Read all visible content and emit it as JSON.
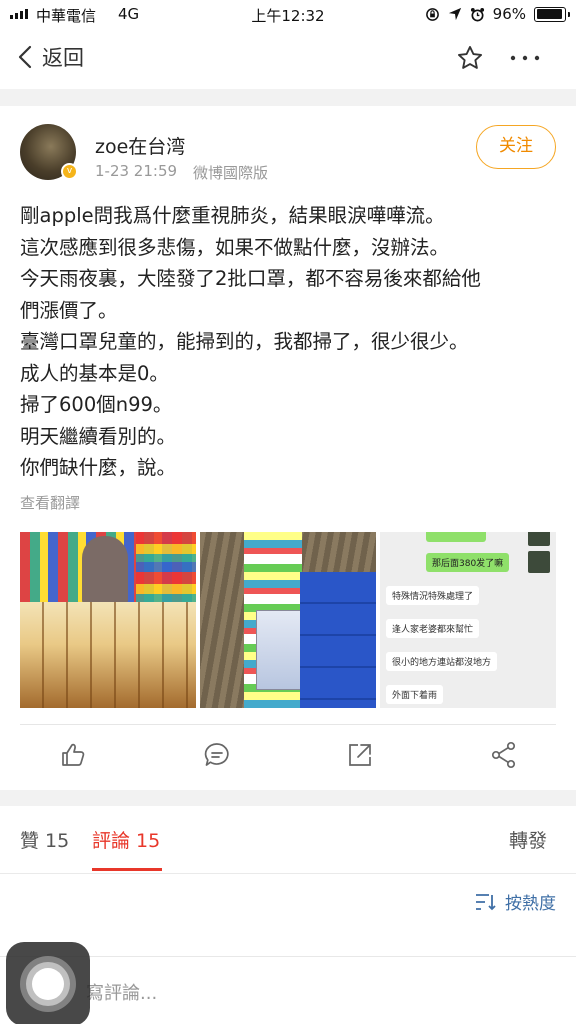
{
  "status_bar": {
    "carrier": "中華電信",
    "network": "4G",
    "time": "上午12:32",
    "battery": "96%",
    "battery_level": 0.96
  },
  "nav": {
    "back_label": "返回",
    "back_icon": "chevron-left-icon",
    "favorite_icon": "star-icon",
    "more_icon": "more-dots-icon"
  },
  "post": {
    "username": "zoe在台湾",
    "time": "1-23 21:59",
    "source": "微博國際版",
    "follow_label": "关注",
    "text_lines": [
      "剛apple問我爲什麼重視肺炎，結果眼淚嘩嘩流。",
      "這次感應到很多悲傷，如果不做點什麼，沒辦法。",
      "今天雨夜裏，大陸發了2批口罩，都不容易後來都給他",
      "們漲價了。",
      "臺灣口罩兒童的，能掃到的，我都掃了，很少很少。",
      "成人的基本是0。",
      "掃了600個n99。",
      "明天繼續看別的。",
      "你們缺什麼，說。"
    ],
    "translate_label": "查看翻譯",
    "chat_lines": [
      "那后面380发了嘛",
      "特殊情況特殊處理了",
      "逢人家老婆都來幫忙",
      "很小的地方連站都沒地方",
      "外面下着雨"
    ]
  },
  "actions": {
    "icons": [
      "like-icon",
      "comment-icon",
      "forward-icon",
      "share-icon"
    ]
  },
  "tabs": {
    "likes": "贊 15",
    "comments": "評論 15",
    "reposts": "轉發"
  },
  "sort_label": "按熱度",
  "comment_input_placeholder": "寫評論...",
  "colors": {
    "accent_red": "#e8372a",
    "follow_orange": "#f5a623",
    "link_blue": "#3f6fa6",
    "chat_green": "#8fe06a"
  }
}
